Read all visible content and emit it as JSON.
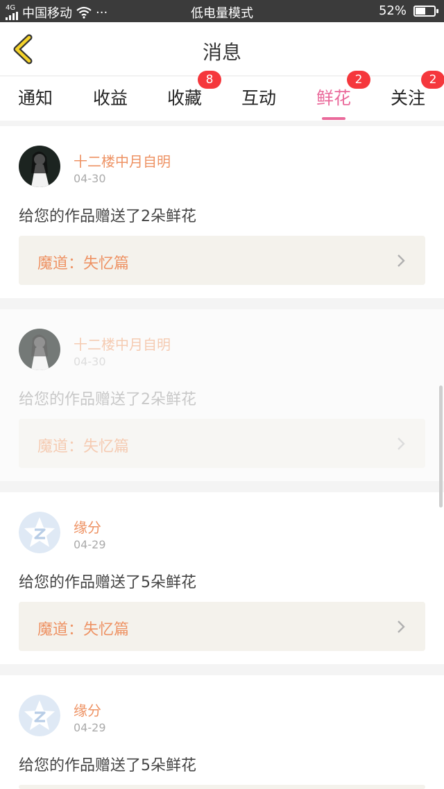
{
  "status_bar": {
    "network": "4G",
    "carrier": "中国移动",
    "more": "···",
    "mode": "低电量模式",
    "battery_text": "52%",
    "battery_level": 0.52
  },
  "nav": {
    "title": "消息"
  },
  "tabs": [
    {
      "label": "通知",
      "badge": ""
    },
    {
      "label": "收益",
      "badge": ""
    },
    {
      "label": "收藏",
      "badge": "8"
    },
    {
      "label": "互动",
      "badge": ""
    },
    {
      "label": "鲜花",
      "badge": "2",
      "active": true
    },
    {
      "label": "关注",
      "badge": "2"
    }
  ],
  "messages": [
    {
      "user": "十二楼中月自明",
      "date": "04-30",
      "text": "给您的作品赠送了2朵鲜花",
      "work": "魔道：失忆篇",
      "avatar": "portrait-avatar"
    },
    {
      "user": "十二楼中月自明",
      "date": "04-30",
      "text": "给您的作品赠送了2朵鲜花",
      "work": "魔道：失忆篇",
      "avatar": "portrait-avatar"
    },
    {
      "user": "缘分",
      "date": "04-29",
      "text": "给您的作品赠送了5朵鲜花",
      "work": "魔道：失忆篇",
      "avatar": "default-star-avatar"
    },
    {
      "user": "缘分",
      "date": "04-29",
      "text": "给您的作品赠送了5朵鲜花",
      "work": "",
      "avatar": "default-star-avatar"
    }
  ],
  "colors": {
    "accent": "#ea6a9b",
    "badge": "#f5373c",
    "name": "#ee9263"
  }
}
